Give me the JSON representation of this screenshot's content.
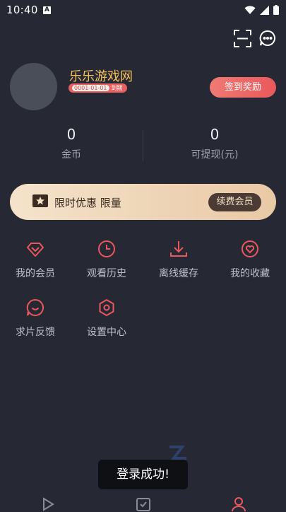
{
  "status": {
    "time": "10:40",
    "indicator": "A"
  },
  "top_icons": [
    "scan-icon",
    "message-icon"
  ],
  "profile": {
    "username": "乐乐游戏网",
    "vip_date": "0001-01-01",
    "vip_expire": "到期",
    "signin_label": "签到奖励"
  },
  "stats": {
    "coins_value": "0",
    "coins_label": "金币",
    "withdraw_value": "0",
    "withdraw_label": "可提现(元)"
  },
  "vip_banner": {
    "text": "限时优惠 限量",
    "button": "续费会员"
  },
  "menu": {
    "items": [
      {
        "label": "我的会员",
        "icon": "diamond-icon"
      },
      {
        "label": "观看历史",
        "icon": "clock-icon"
      },
      {
        "label": "离线缓存",
        "icon": "download-icon"
      },
      {
        "label": "我的收藏",
        "icon": "heart-icon"
      },
      {
        "label": "求片反馈",
        "icon": "chat-icon"
      },
      {
        "label": "设置中心",
        "icon": "settings-icon"
      }
    ]
  },
  "toast": {
    "text": "登录成功!"
  },
  "colors": {
    "background": "#262934",
    "accent": "#e8585c",
    "gold": "#f4c05a"
  }
}
